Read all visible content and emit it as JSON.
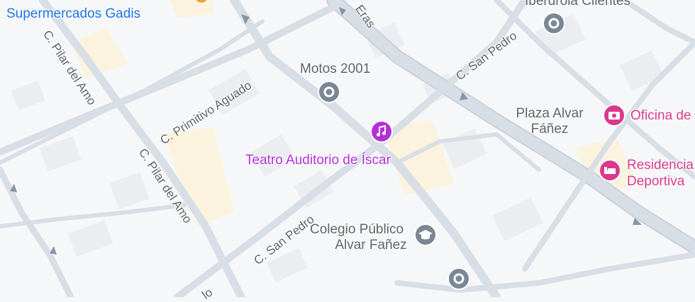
{
  "places": {
    "supermercados": "Supermercados Gadis",
    "iberdrola": "Iberdrola Clientes",
    "motos": "Motos 2001",
    "plaza_line1": "Plaza Alvar",
    "plaza_line2": "Fáñez",
    "oficina": "Oficina de",
    "teatro": "Teatro Auditorio de Íscar",
    "residencia_line1": "Residencia",
    "residencia_line2": "Deportiva",
    "colegio_line1": "Colegio Público",
    "colegio_line2": "Alvar Fañez"
  },
  "streets": {
    "pilar_del_amo_1": "C. Pilar del Amo",
    "pilar_del_amo_2": "C. Pilar del Amo",
    "primitivo_aguado": "C. Primitivo Aguado",
    "san_pedro_1": "C. San Pedro",
    "san_pedro_2": "C. San Pedro",
    "eras": "Eras",
    "bottom_partial": "lo"
  },
  "colors": {
    "road": "#d8dee6",
    "road_edge": "#c9d1db",
    "background": "#f6f7f8",
    "building": "#ebedf0",
    "sand": "#fbf3dd",
    "pin_gray": "#7b8794",
    "pin_purple": "#b430d8",
    "pin_pink": "#d93a8e",
    "text_blue": "#1a73e8"
  },
  "icons": {
    "motos": "place-pin-icon",
    "iberdrola": "place-pin-icon",
    "teatro": "music-note-icon",
    "colegio": "school-cap-icon",
    "oficina": "camera-icon",
    "residencia": "bed-icon",
    "bottom": "place-pin-icon"
  }
}
